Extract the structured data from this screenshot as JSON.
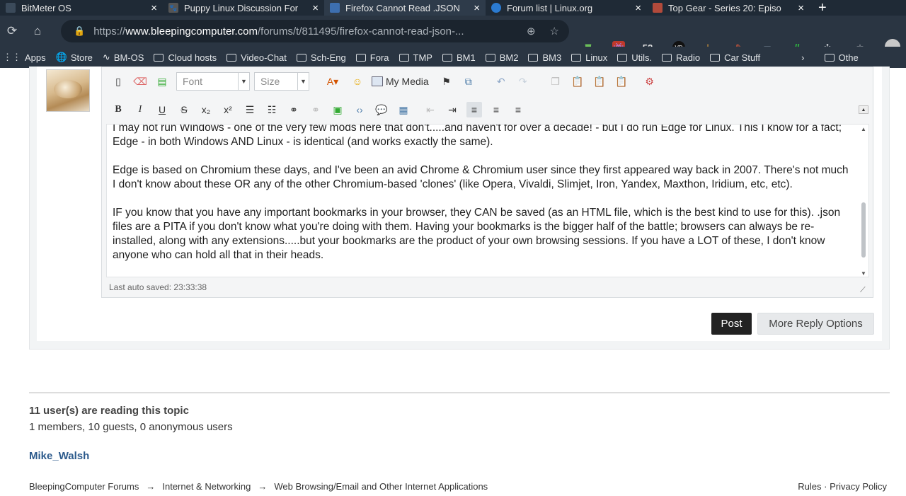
{
  "browser": {
    "tabs": [
      {
        "label": "BitMeter OS",
        "icon_color": "#3b4a5a"
      },
      {
        "label": "Puppy Linux Discussion For",
        "icon_color": "#555555"
      },
      {
        "label": "Firefox Cannot Read .JSON",
        "icon_color": "#3d6fb0"
      },
      {
        "label": "Forum list | Linux.org",
        "icon_color": "#2b7bd1"
      },
      {
        "label": "Top Gear - Series 20: Episo",
        "icon_color": "#b24a3b"
      }
    ],
    "url_prefix": "https://",
    "url_domain": "www.bleepingcomputer.com",
    "url_path": "/forums/t/811495/firefox-cannot-read-json-...",
    "ext_badge": "52",
    "bookmarks": [
      "Apps",
      "Store",
      "BM-OS",
      "Cloud hosts",
      "Video-Chat",
      "Sch-Eng",
      "Fora",
      "TMP",
      "BM1",
      "BM2",
      "BM3",
      "Linux",
      "Utils.",
      "Radio",
      "Car Stuff"
    ],
    "bookmarks_other": "Othe"
  },
  "editor": {
    "font_placeholder": "Font",
    "size_placeholder": "Size",
    "my_media": "My Media",
    "paragraphs": [
      "I may not run Windows - one of the very few mods here that don't.....and haven't for over a decade! - but I do run Edge for Linux. This I know for a fact; Edge - in both Windows AND Linux - is identical (and works exactly the same).",
      "Edge is based on Chromium these days, and I've been an avid Chrome & Chromium user since they first appeared way back in 2007. There's not much I don't know about these OR any of the other Chromium-based 'clones' (like Opera, Vivaldi, Slimjet, Iron, Yandex, Maxthon, Iridium, etc, etc).",
      "IF you know that you have any important bookmarks in your browser, they CAN be saved (as an HTML file, which is the best kind to use for this). .json files are a PITA if you don't know what you're doing with them. Having your bookmarks is the bigger half of the battle; browsers can always be re-installed, along with any extensions.....but your bookmarks are the product of your own browsing sessions. If you have a LOT of these, I don't know anyone who can hold all that in their heads."
    ],
    "autosave": "Last auto saved: 23:33:38"
  },
  "actions": {
    "post": "Post",
    "more": "More Reply Options"
  },
  "readers": {
    "title": "11 user(s) are reading this topic",
    "count": "1 members, 10 guests, 0 anonymous users",
    "member": "Mike_Walsh"
  },
  "footer": {
    "crumbs": [
      "BleepingComputer Forums",
      "Internet & Networking",
      "Web Browsing/Email and Other Internet Applications"
    ],
    "crumb_sep": "→",
    "links": "Rules · Privacy Policy"
  }
}
